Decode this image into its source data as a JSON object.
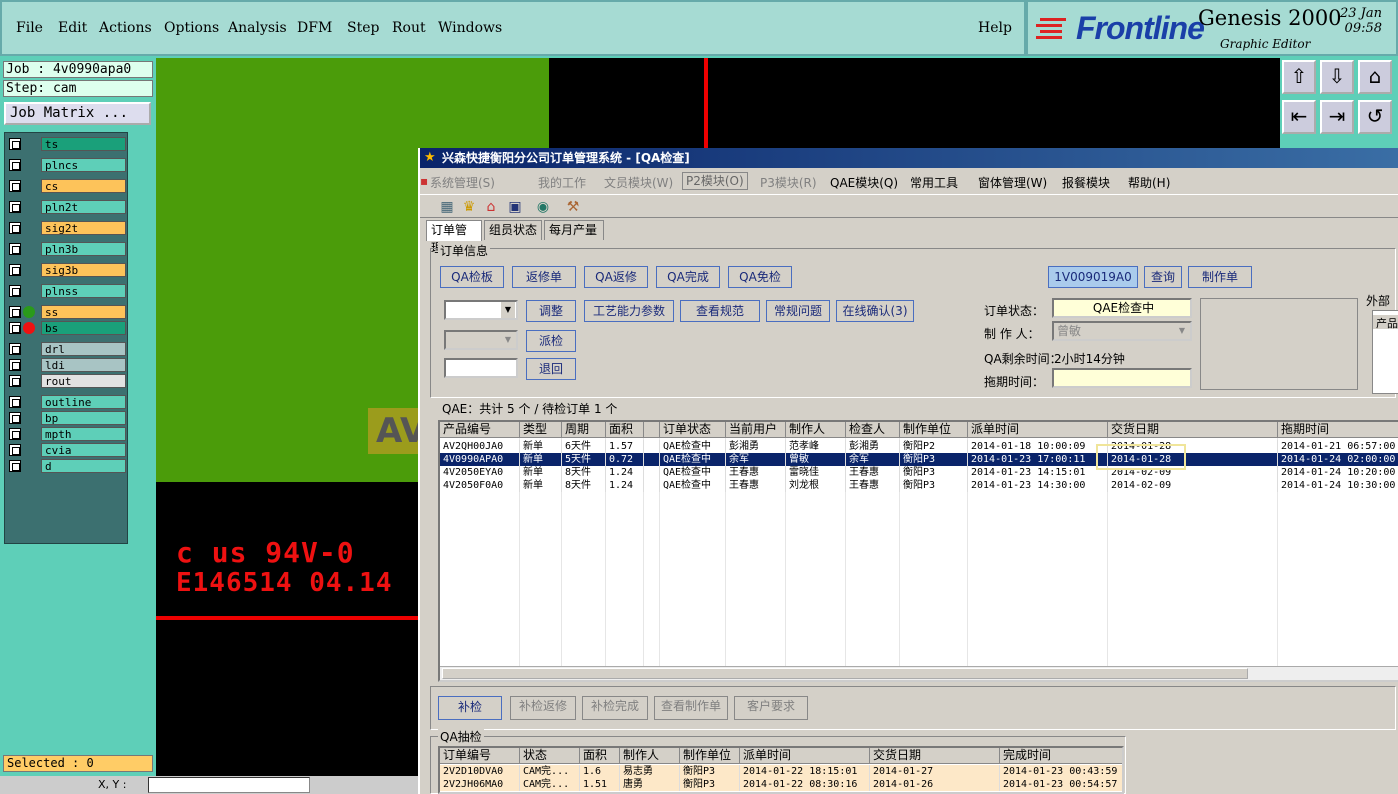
{
  "genesis": {
    "menu": [
      "File",
      "Edit",
      "Actions",
      "Options",
      "Analysis",
      "DFM",
      "Step",
      "Rout",
      "Windows"
    ],
    "help": "Help",
    "brand": "Frontline",
    "product": "Genesis 2000",
    "subtitle": "Graphic Editor",
    "date": "23 Jan",
    "time": "09:58",
    "job_label": "Job : 4v0990apa0",
    "step_label": "Step: cam",
    "job_matrix": "Job Matrix ...",
    "selected": "Selected : 0",
    "layers": [
      {
        "name": "ts",
        "color": "#1aa07a",
        "dot": ""
      },
      {
        "name": "plncs",
        "color": "#5ecfb8",
        "dot": ""
      },
      {
        "name": "cs",
        "color": "#fdc35a",
        "dot": ""
      },
      {
        "name": "pln2t",
        "color": "#5ecfb8",
        "dot": ""
      },
      {
        "name": "sig2t",
        "color": "#fdc35a",
        "dot": ""
      },
      {
        "name": "pln3b",
        "color": "#5ecfb8",
        "dot": ""
      },
      {
        "name": "sig3b",
        "color": "#fdc35a",
        "dot": ""
      },
      {
        "name": "plnss",
        "color": "#5ecfb8",
        "dot": ""
      },
      {
        "name": "ss",
        "color": "#fdc35a",
        "dot": "#2a9a1a"
      },
      {
        "name": "bs",
        "color": "#1aa07a",
        "dot": "#e11"
      },
      {
        "name": "drl",
        "color": "#a8c4c4",
        "dot": ""
      },
      {
        "name": "ldi",
        "color": "#a8c4c4",
        "dot": ""
      },
      {
        "name": "rout",
        "color": "#e2e2e2",
        "dot": ""
      },
      {
        "name": "outline",
        "color": "#5ecfb8",
        "dot": ""
      },
      {
        "name": "bp",
        "color": "#5ecfb8",
        "dot": ""
      },
      {
        "name": "mpth",
        "color": "#5ecfb8",
        "dot": ""
      },
      {
        "name": "cvia",
        "color": "#5ecfb8",
        "dot": ""
      },
      {
        "name": "d",
        "color": "#5ecfb8",
        "dot": ""
      }
    ],
    "silk_line1": "c  us  94V-0",
    "silk_line2": "E146514 04.14",
    "yellow_text": "AV",
    "bottom_coord": "X, Y :"
  },
  "qa": {
    "title": "兴森快捷衡阳分公司订单管理系统 - [QA检查]",
    "menu": [
      {
        "label": "系统管理(S)",
        "state": "dis"
      },
      {
        "label": "我的工作",
        "state": "dis"
      },
      {
        "label": "文员模块(W)",
        "state": "dis"
      },
      {
        "label": "P2模块(O)",
        "state": "sel"
      },
      {
        "label": "P3模块(R)",
        "state": "dis"
      },
      {
        "label": "QAE模块(Q)",
        "state": ""
      },
      {
        "label": "常用工具",
        "state": ""
      },
      {
        "label": "窗体管理(W)",
        "state": ""
      },
      {
        "label": "报餐模块",
        "state": ""
      },
      {
        "label": "帮助(H)",
        "state": ""
      }
    ],
    "tabs": [
      "订单管理",
      "组员状态",
      "每月产量"
    ],
    "order_info_label": "订单信息",
    "buttons_row1": [
      "QA检板",
      "返修单",
      "QA返修",
      "QA完成",
      "QA免检"
    ],
    "order_no": "1V009019A0",
    "query": "查询",
    "make_order": "制作单",
    "buttons_row2": [
      "调整",
      "工艺能力参数",
      "查看规范",
      "常规问题",
      "在线确认(3)"
    ],
    "dispatch": "派检",
    "return": "退回",
    "status_label": "订单状态：",
    "status_value": "QAE检查中",
    "maker_label": "制 作 人：",
    "maker_value": "曾敏",
    "remaining_label": "QA剩余时间：",
    "remaining_value": "2小时14分钟",
    "delay_label": "拖期时间：",
    "ext_label": "外部",
    "ext_col": "产品",
    "summary": "QAE：共计 5 个 / 待检订单 1 个",
    "columns": [
      "产品编号",
      "类型",
      "周期",
      "面积",
      "",
      "订单状态",
      "当前用户",
      "制作人",
      "检查人",
      "制作单位",
      "派单时间",
      "交货日期",
      "拖期时间"
    ],
    "rows": [
      [
        "AV2QH00JA0",
        "新单",
        "6天件",
        "1.57",
        "",
        "QAE检查中",
        "彭湘勇",
        "范孝峰",
        "彭湘勇",
        "衡阳P2",
        "2014-01-18 10:00:09",
        "2014-01-28",
        "2014-01-21 06:57:00"
      ],
      [
        "4V0990APA0",
        "新单",
        "5天件",
        "0.72",
        "",
        "QAE检查中",
        "余军",
        "曾敏",
        "余军",
        "衡阳P3",
        "2014-01-23 17:00:11",
        "2014-01-28",
        "2014-01-24 02:00:00"
      ],
      [
        "4V2050EYA0",
        "新单",
        "8天件",
        "1.24",
        "",
        "QAE检查中",
        "王春惠",
        "雷晓佳",
        "王春惠",
        "衡阳P3",
        "2014-01-23 14:15:01",
        "2014-02-09",
        "2014-01-24 10:20:00"
      ],
      [
        "4V2050F0A0",
        "新单",
        "8天件",
        "1.24",
        "",
        "QAE检查中",
        "王春惠",
        "刘龙根",
        "王春惠",
        "衡阳P3",
        "2014-01-23 14:30:00",
        "2014-02-09",
        "2014-01-24 10:30:00"
      ]
    ],
    "selected_row": 1,
    "bottom_buttons": [
      {
        "label": "补检",
        "state": "blue"
      },
      {
        "label": "补检返修",
        "state": "dis"
      },
      {
        "label": "补检完成",
        "state": "dis"
      },
      {
        "label": "查看制作单",
        "state": "dis"
      },
      {
        "label": "客户要求",
        "state": "dis"
      }
    ],
    "spot_label": "QA抽检",
    "spot_columns": [
      "订单编号",
      "状态",
      "面积",
      "制作人",
      "制作单位",
      "派单时间",
      "交货日期",
      "完成时间"
    ],
    "spot_rows": [
      [
        "2V2D10DVA0",
        "CAM完...",
        "1.6",
        "易志勇",
        "衡阳P3",
        "2014-01-22 18:15:01",
        "2014-01-27",
        "2014-01-23 00:43:59"
      ],
      [
        "2V2JH06MA0",
        "CAM完...",
        "1.51",
        "唐勇",
        "衡阳P3",
        "2014-01-22 08:30:16",
        "2014-01-26",
        "2014-01-23 00:54:57"
      ]
    ]
  }
}
